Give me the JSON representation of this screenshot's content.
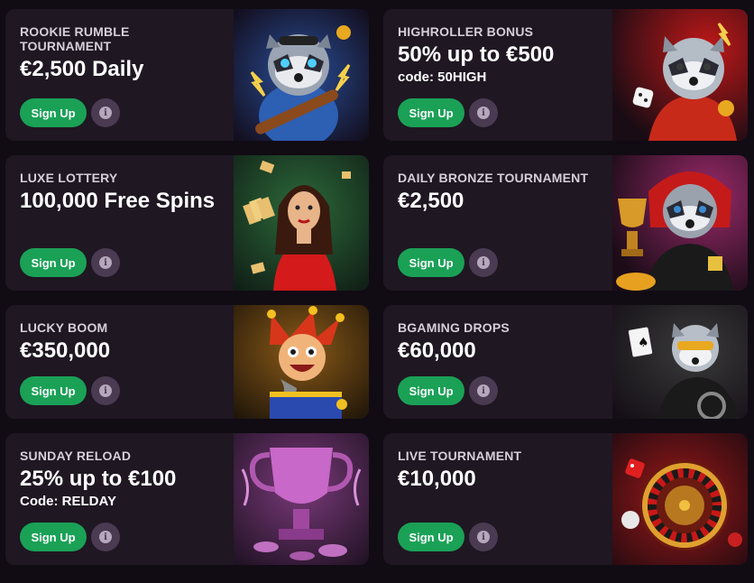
{
  "cards": [
    {
      "label": "ROOKIE RUMBLE TOURNAMENT",
      "amount": "€2,500 Daily",
      "code": "",
      "signup_label": "Sign Up",
      "info_icon": "i",
      "illustration": "raccoon-guitar-illustration",
      "accent": "#1f3c78"
    },
    {
      "label": "HIGHROLLER BONUS",
      "amount": "50% up to €500",
      "code": "code: 50HIGH",
      "signup_label": "Sign Up",
      "info_icon": "i",
      "illustration": "raccoon-dice-illustration",
      "accent": "#8a1414"
    },
    {
      "label": "LUXE LOTTERY",
      "amount": "100,000 Free Spins",
      "code": "",
      "signup_label": "Sign Up",
      "info_icon": "i",
      "illustration": "woman-red-dress-illustration",
      "accent": "#1c4d2a"
    },
    {
      "label": "DAILY BRONZE TOURNAMENT",
      "amount": "€2,500",
      "code": "",
      "signup_label": "Sign Up",
      "info_icon": "i",
      "illustration": "raccoon-trophy-illustration",
      "accent": "#6a1740"
    },
    {
      "label": "LUCKY BOOM",
      "amount": "€350,000",
      "code": "",
      "signup_label": "Sign Up",
      "info_icon": "i",
      "illustration": "jester-box-illustration",
      "accent": "#7a5410"
    },
    {
      "label": "BGAMING DROPS",
      "amount": "€60,000",
      "code": "",
      "signup_label": "Sign Up",
      "info_icon": "i",
      "illustration": "raccoon-motorbike-illustration",
      "accent": "#2c2c2c"
    },
    {
      "label": "SUNDAY RELOAD",
      "amount": "25% up to €100",
      "code": "Code: RELDAY",
      "signup_label": "Sign Up",
      "info_icon": "i",
      "illustration": "pink-trophy-illustration",
      "accent": "#6e2a6a"
    },
    {
      "label": "LIVE TOURNAMENT",
      "amount": "€10,000",
      "code": "",
      "signup_label": "Sign Up",
      "info_icon": "i",
      "illustration": "roulette-wheel-illustration",
      "accent": "#8c1616"
    }
  ]
}
